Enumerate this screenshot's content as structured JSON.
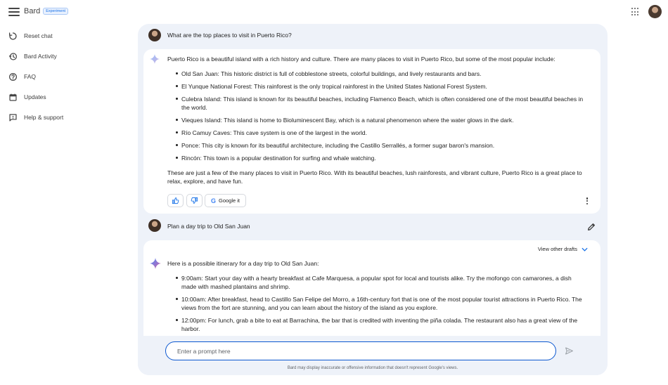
{
  "header": {
    "app_name": "Bard",
    "badge": "Experiment",
    "menu_icon": "hamburger-menu-icon",
    "apps_icon": "google-apps-grid-icon"
  },
  "sidebar": {
    "items": [
      {
        "label": "Reset chat",
        "icon": "reset-icon"
      },
      {
        "label": "Bard Activity",
        "icon": "history-icon"
      },
      {
        "label": "FAQ",
        "icon": "help-circle-icon"
      },
      {
        "label": "Updates",
        "icon": "calendar-icon"
      },
      {
        "label": "Help & support",
        "icon": "feedback-icon"
      }
    ]
  },
  "conversation": {
    "turn1": {
      "question": "What are the top places to visit in Puerto Rico?",
      "intro": "Puerto Rico is a beautiful island with a rich history and culture. There are many places to visit in Puerto Rico, but some of the most popular include:",
      "bullets": [
        "Old San Juan: This historic district is full of cobblestone streets, colorful buildings, and lively restaurants and bars.",
        "El Yunque National Forest: This rainforest is the only tropical rainforest in the United States National Forest System.",
        "Culebra Island: This island is known for its beautiful beaches, including Flamenco Beach, which is often considered one of the most beautiful beaches in the world.",
        "Vieques Island: This island is home to Bioluminescent Bay, which is a natural phenomenon where the water glows in the dark.",
        "Río Camuy Caves: This cave system is one of the largest in the world.",
        "Ponce: This city is known for its beautiful architecture, including the Castillo Serrallés, a former sugar baron's mansion.",
        "Rincón: This town is a popular destination for surfing and whale watching."
      ],
      "outro": "These are just a few of the many places to visit in Puerto Rico. With its beautiful beaches, lush rainforests, and vibrant culture, Puerto Rico is a great place to relax, explore, and have fun.",
      "google_it_label": "Google it"
    },
    "turn2": {
      "question": "Plan a day trip to Old San Juan",
      "view_drafts_label": "View other drafts",
      "intro": "Here is a possible itinerary for a day trip to Old San Juan:",
      "bullets": [
        "9:00am: Start your day with a hearty breakfast at Cafe Marquesa, a popular spot for local and tourists alike. Try the mofongo con camarones, a dish made with mashed plantains and shrimp.",
        "10:00am: After breakfast, head to Castillo San Felipe del Morro, a 16th-century fort that is one of the most popular tourist attractions in Puerto Rico. The views from the fort are stunning, and you can learn about the history of the island as you explore.",
        "12:00pm: For lunch, grab a bite to eat at Barrachina, the bar that is credited with inventing the piña colada. The restaurant also has a great view of the harbor."
      ]
    }
  },
  "prompt": {
    "placeholder": "Enter a prompt here",
    "disclaimer": "Bard may display inaccurate or offensive information that doesn't represent Google's views."
  },
  "colors": {
    "panel_bg": "#eef2f9",
    "accent": "#0b57d0"
  }
}
